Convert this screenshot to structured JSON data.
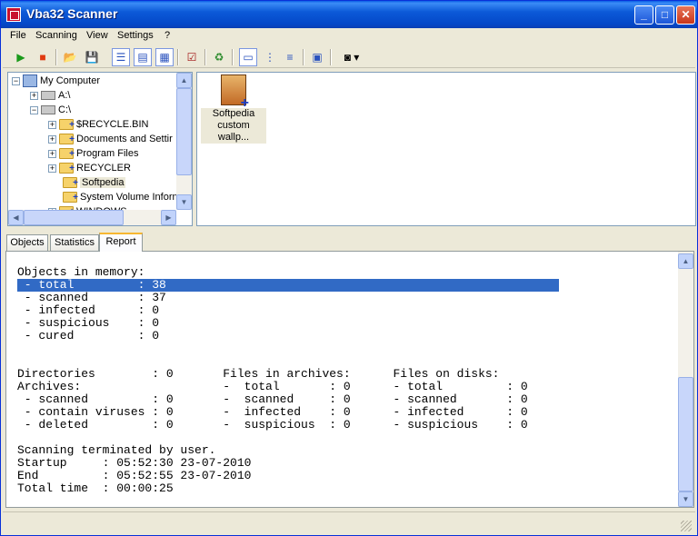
{
  "window": {
    "title": "Vba32 Scanner"
  },
  "menu": [
    "File",
    "Scanning",
    "View",
    "Settings",
    "?"
  ],
  "toolbar": {
    "icons": [
      "play-icon",
      "stop-icon",
      "scan-folder-icon",
      "save-icon",
      "tree-view-icon",
      "details-view-icon",
      "grid-view-icon",
      "checklist-icon",
      "quarantine-icon",
      "large-icons-view-icon",
      "tree-list-icon",
      "list-view-icon",
      "report-icon",
      "options-icon"
    ]
  },
  "tree": {
    "items": [
      {
        "label": "My Computer",
        "type": "computer",
        "expander": "-"
      },
      {
        "label": "A:\\",
        "type": "drive",
        "expander": "+"
      },
      {
        "label": "C:\\",
        "type": "drive",
        "expander": "-"
      },
      {
        "label": "$RECYCLE.BIN",
        "type": "folder",
        "expander": "+"
      },
      {
        "label": "Documents and Settir",
        "type": "folder",
        "expander": "+"
      },
      {
        "label": "Program Files",
        "type": "folder",
        "expander": "+"
      },
      {
        "label": "RECYCLER",
        "type": "folder",
        "expander": "+"
      },
      {
        "label": "Softpedia",
        "type": "folder",
        "expander": ""
      },
      {
        "label": "System Volume Inforn",
        "type": "folder",
        "expander": ""
      },
      {
        "label": "WINDOWS",
        "type": "folder",
        "expander": "+"
      }
    ]
  },
  "file_list": {
    "items": [
      {
        "label_line1": "Softpedia",
        "label_line2": "custom wallp..."
      }
    ]
  },
  "tabs": [
    "Objects",
    "Statistics",
    "Report"
  ],
  "active_tab": "Report",
  "report": {
    "lines": [
      "Objects in memory:",
      " - total         : 38",
      " - scanned       : 37",
      " - infected      : 0",
      " - suspicious    : 0",
      " - cured         : 0",
      "",
      "",
      "Directories        : 0       Files in archives:      Files on disks:",
      "Archives:                    -  total       : 0      - total         : 0",
      " - scanned         : 0       -  scanned     : 0      - scanned       : 0",
      " - contain viruses : 0       -  infected    : 0      - infected      : 0",
      " - deleted         : 0       -  suspicious  : 0      - suspicious    : 0",
      "",
      "Scanning terminated by user.",
      "Startup     : 05:52:30 23-07-2010",
      "End         : 05:52:55 23-07-2010",
      "Total time  : 00:00:25"
    ],
    "selected_line": 1
  },
  "colors": {
    "titlebar": "#0a5ee6",
    "selection": "#316ac5",
    "window_bg": "#ece9d8"
  }
}
